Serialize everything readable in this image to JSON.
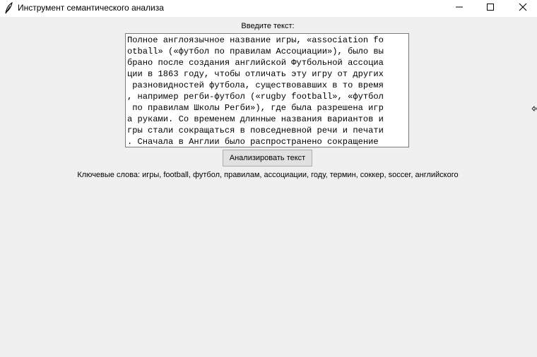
{
  "window": {
    "title": "Инструмент семантического анализа",
    "icon": "feather-icon",
    "controls": [
      "minimize-icon",
      "maximize-icon",
      "close-icon"
    ]
  },
  "form": {
    "input_label": "Введите текст:",
    "text_lines": [
      "Полное англоязычное название игры, «association fo",
      "otball» («футбол по правилам Ассоциации»), было вы",
      "брано после создания английской Футбольной ассоциа",
      "ции в 1863 году, чтобы отличать эту игру от других",
      " разновидностей футбола, существовавших в то время",
      ", например регби-футбол («rugby football», «футбол",
      " по правилам Школы Регби»), где была разрешена игр",
      "а руками. Со временем длинные названия вариантов и",
      "гры стали сокращаться в повседневной речи и печати",
      ". Сначала в Англии было распространено сокращение "
    ],
    "analyze_button": "Анализировать текст",
    "keywords_result": "Ключевые слова: игры, football, футбол, правилам, ассоциации, году, термин, соккер, soccer, английского"
  }
}
